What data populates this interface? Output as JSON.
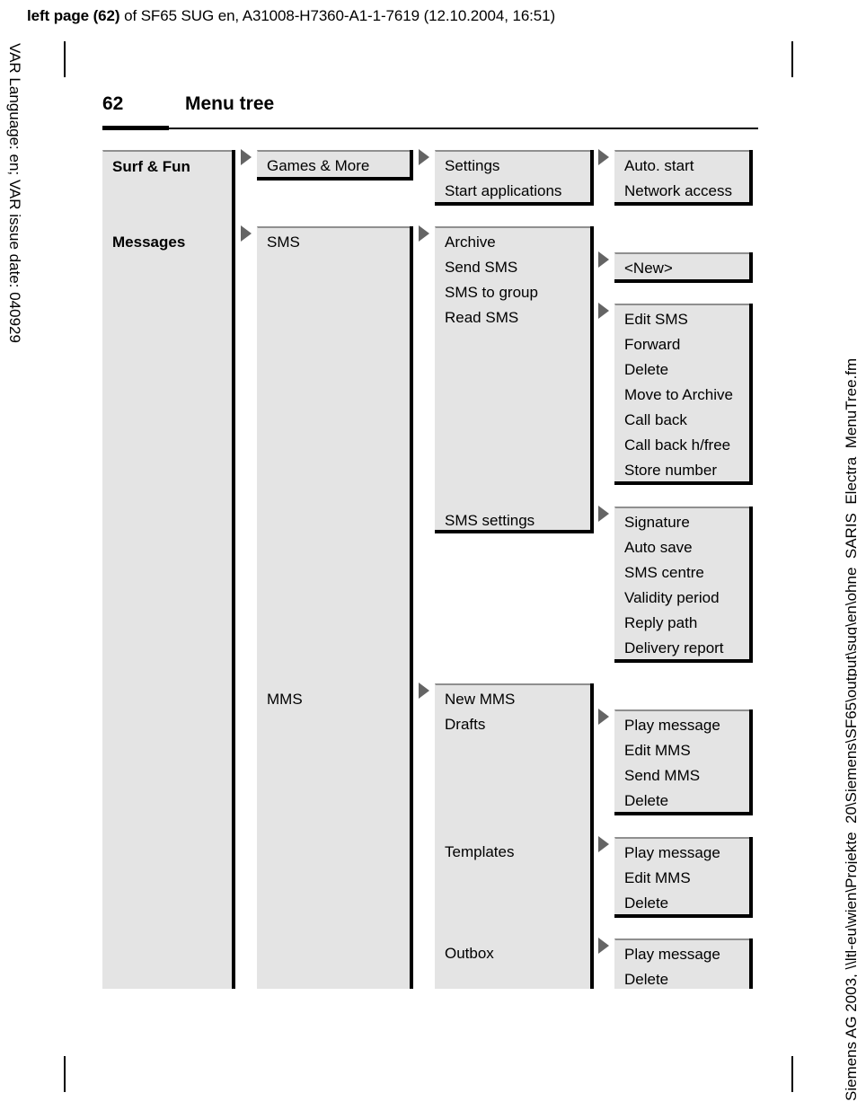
{
  "print_header": {
    "bold_part": "left page (62)",
    "rest": " of SF65 SUG en, A31008-H7360-A1-1-7619 (12.10.2004, 16:51)"
  },
  "side_text": {
    "left": "VAR Language: en; VAR issue date: 040929",
    "right": "Siemens AG 2003, \\\\ltl-eu\\wien\\Projekte_20\\Siemens\\SF65\\output\\sug\\en\\ohne_SARIS_Electra_MenuTree.fm"
  },
  "page": {
    "number": "62",
    "chapter_title": "Menu tree"
  },
  "colors": {
    "box_fill": "#e4e4e4",
    "box_top_border": "#8f8f8f",
    "box_shadow": "#000000",
    "arrow": "#646464"
  },
  "tree": {
    "column1": {
      "label": "level-1-menu",
      "boxes": [
        {
          "name": "surf-and-fun",
          "items": [
            "Surf & Fun"
          ]
        },
        {
          "name": "messages",
          "items": [
            "Messages"
          ]
        }
      ]
    },
    "column2": {
      "label": "level-2-menu",
      "boxes": [
        {
          "name": "games-and-more",
          "items": [
            "Games & More"
          ]
        },
        {
          "name": "sms",
          "items": [
            "SMS"
          ]
        },
        {
          "name": "mms",
          "items": [
            "MMS"
          ]
        }
      ]
    },
    "column3": {
      "label": "level-3-menu",
      "boxes": [
        {
          "name": "games-and-more-submenu",
          "items": [
            "Settings",
            "Start applications"
          ]
        },
        {
          "name": "sms-submenu",
          "items": [
            "Archive",
            "Send SMS",
            "SMS to group",
            "Read SMS",
            "SMS settings"
          ]
        },
        {
          "name": "mms-submenu",
          "items": [
            "New MMS",
            "Drafts",
            "Templates",
            "Outbox"
          ]
        }
      ]
    },
    "column4": {
      "label": "level-4-menu",
      "boxes": [
        {
          "name": "settings-submenu",
          "items": [
            "Auto. start",
            "Network access"
          ]
        },
        {
          "name": "archive-submenu",
          "items": [
            "<New>"
          ]
        },
        {
          "name": "read-sms-submenu",
          "items": [
            "Edit SMS",
            "Forward",
            "Delete",
            "Move to Archive",
            "Call back",
            "Call back h/free",
            "Store number"
          ]
        },
        {
          "name": "sms-settings-submenu",
          "items": [
            "Signature",
            "Auto save",
            "SMS centre",
            "Validity period",
            "Reply path",
            "Delivery report"
          ]
        },
        {
          "name": "drafts-submenu",
          "items": [
            "Play message",
            "Edit MMS",
            "Send MMS",
            "Delete"
          ]
        },
        {
          "name": "templates-submenu",
          "items": [
            "Play message",
            "Edit MMS",
            "Delete"
          ]
        },
        {
          "name": "outbox-submenu",
          "items": [
            "Play message",
            "Delete"
          ]
        }
      ]
    }
  }
}
